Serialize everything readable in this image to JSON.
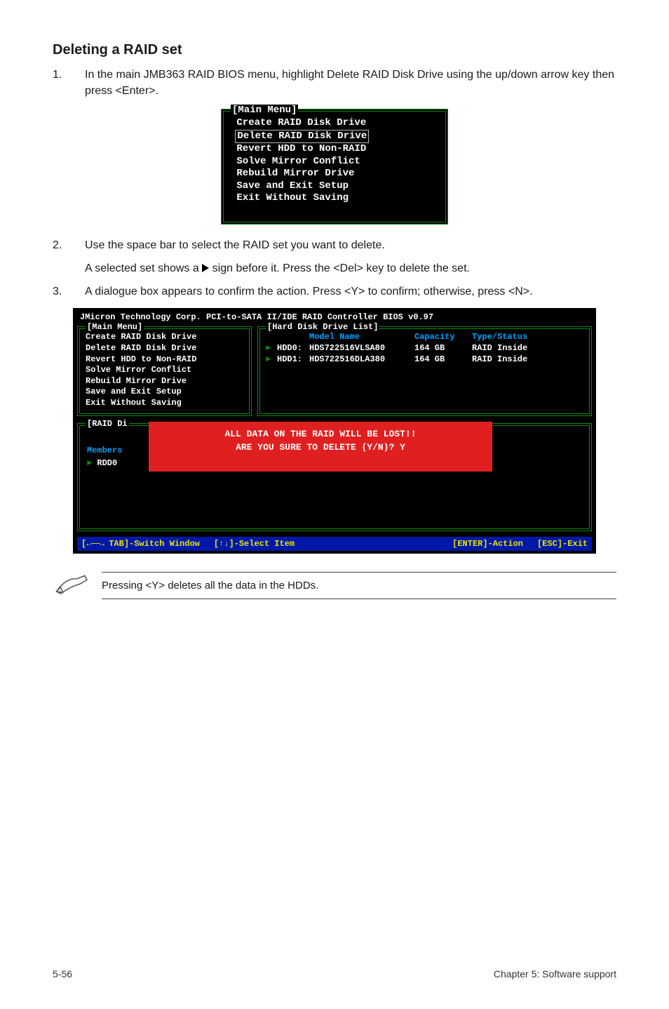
{
  "heading": "Deleting a RAID set",
  "step1": {
    "n": "1.",
    "text": "In the main JMB363 RAID BIOS menu, highlight Delete RAID Disk Drive using the up/down arrow key then press <Enter>."
  },
  "main_menu": {
    "legend": "[Main Menu]",
    "items": [
      "Create RAID Disk Drive",
      "Delete RAID Disk Drive",
      "Revert HDD to Non-RAID",
      "Solve Mirror Conflict",
      "Rebuild Mirror Drive",
      "Save and Exit Setup",
      "Exit Without Saving"
    ]
  },
  "step2": {
    "n": "2.",
    "text": "Use the space bar to select the RAID set you want to delete.",
    "sub": "A selected set shows a      sign before it. Press the <Del> key to delete the set.",
    "sub_prefix": "A selected set shows a ",
    "sub_suffix": " sign before it. Press the <Del> key to delete the set."
  },
  "step3": {
    "n": "3.",
    "text": "A dialogue box appears to confirm the action. Press <Y> to confirm; otherwise, press <N>."
  },
  "bios": {
    "title": "JMicron Technology Corp. PCI-to-SATA II/IDE RAID Controller BIOS v0.97",
    "main_legend": "[Main Menu]",
    "hdl_legend": "[Hard Disk Drive List]",
    "main_items": [
      "Create RAID Disk Drive",
      "Delete RAID Disk Drive",
      "Revert HDD to Non-RAID",
      "Solve Mirror Conflict",
      "Rebuild Mirror Drive",
      "Save and Exit Setup",
      "Exit Without Saving"
    ],
    "hdl_headers": {
      "model": "Model Name",
      "capacity": "Capacity",
      "type": "Type/Status"
    },
    "hdl_rows": [
      {
        "slot": "HDD0:",
        "model": "HDS722516VLSA80",
        "capacity": "164 GB",
        "type": "RAID Inside"
      },
      {
        "slot": "HDD1:",
        "model": "HDS722516DLA380",
        "capacity": "164 GB",
        "type": "RAID Inside"
      }
    ],
    "raid_legend": "[RAID Di",
    "members_label": "Members",
    "rdd_label": "RDD0",
    "overlay_l1": "ALL DATA ON THE RAID WILL BE LOST!!",
    "overlay_l2": "ARE YOU SURE TO DELETE (Y/N)? Y",
    "keybar": {
      "switch": "TAB]-Switch Window",
      "select": "[↑↓]-Select Item",
      "enter": "[ENTER]-Action",
      "esc": "[ESC]-Exit"
    }
  },
  "note": "Pressing <Y> deletes all the data in the HDDs.",
  "footer": {
    "left": "5-56",
    "right": "Chapter 5: Software support"
  }
}
